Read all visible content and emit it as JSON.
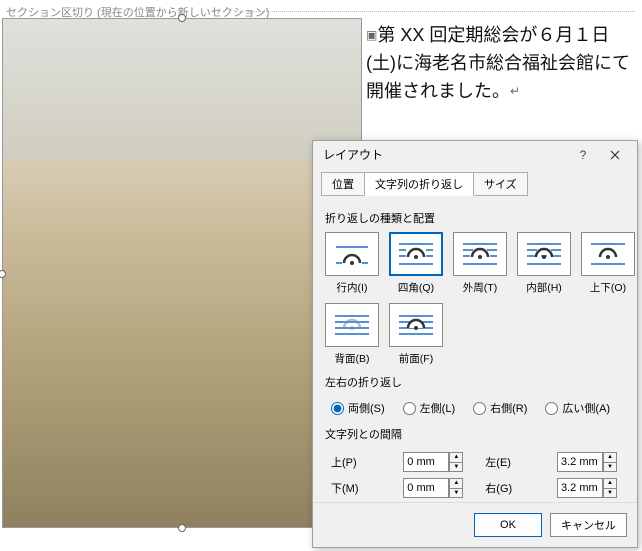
{
  "doc": {
    "section_break": "セクション区切り (現在の位置から新しいセクション)",
    "body_text": "第 XX 回定期総会が６月１日(土)に海老名市総合福祉会館にて開催されました。"
  },
  "dialog": {
    "title": "レイアウト",
    "help_tooltip": "?",
    "tabs": {
      "position": "位置",
      "wrap": "文字列の折り返し",
      "size": "サイズ"
    },
    "wrap_section": {
      "label": "折り返しの種類と配置",
      "options": {
        "inline": "行内(I)",
        "square": "四角(Q)",
        "tight": "外周(T)",
        "through": "内部(H)",
        "topbottom": "上下(O)",
        "behind": "背面(B)",
        "infront": "前面(F)"
      }
    },
    "lr_wrap": {
      "label": "左右の折り返し",
      "both": "両側(S)",
      "left": "左側(L)",
      "right": "右側(R)",
      "largest": "広い側(A)"
    },
    "distance": {
      "label": "文字列との間隔",
      "top_label": "上(P)",
      "bottom_label": "下(M)",
      "left_label": "左(E)",
      "right_label": "右(G)",
      "top": "0 mm",
      "bottom": "0 mm",
      "left": "3.2 mm",
      "right": "3.2 mm"
    },
    "buttons": {
      "ok": "OK",
      "cancel": "キャンセル"
    }
  }
}
